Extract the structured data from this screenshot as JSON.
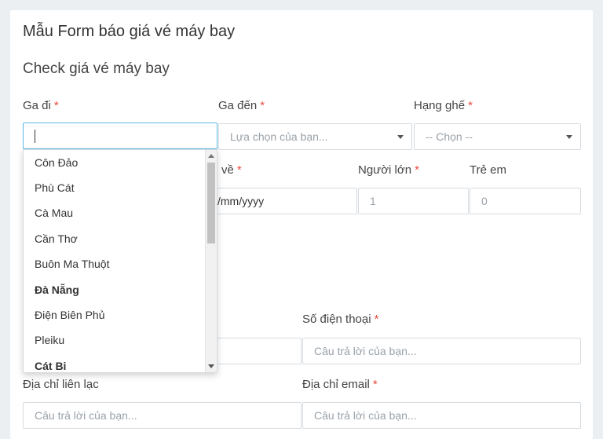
{
  "form": {
    "title": "Mẫu Form báo giá vé máy bay",
    "section_title": "Check giá vé máy bay",
    "required_mark": "*"
  },
  "fields": {
    "departure": {
      "label": "Ga đi",
      "value": ""
    },
    "arrival": {
      "label": "Ga đến",
      "placeholder": "Lựa chọn của bạn..."
    },
    "seat_class": {
      "label": "Hạng ghế",
      "placeholder": "-- Chọn --"
    },
    "return_date": {
      "label": "về",
      "placeholder": "/mm/yyyy"
    },
    "adults": {
      "label": "Người lớn",
      "placeholder": "1"
    },
    "children": {
      "label": "Trẻ em",
      "placeholder": "0"
    },
    "phone": {
      "label": "Số điện thoại",
      "placeholder": "Câu trả lời của bạn..."
    },
    "address": {
      "label": "Địa chỉ liên lạc",
      "placeholder": "Câu trả lời của bạn..."
    },
    "email": {
      "label": "Địa chỉ email",
      "placeholder": "Câu trả lời của bạn..."
    }
  },
  "dropdown": {
    "items": [
      {
        "label": "Côn Đảo",
        "bold": false
      },
      {
        "label": "Phù Cát",
        "bold": false
      },
      {
        "label": "Cà Mau",
        "bold": false
      },
      {
        "label": "Cần Thơ",
        "bold": false
      },
      {
        "label": "Buôn Ma Thuột",
        "bold": false
      },
      {
        "label": "Đà Nẵng",
        "bold": true
      },
      {
        "label": "Điện Biên Phủ",
        "bold": false
      },
      {
        "label": "Pleiku",
        "bold": false
      },
      {
        "label": "Cát Bi",
        "bold": true
      }
    ]
  },
  "colors": {
    "required": "#e74c3c",
    "focus_border": "#5bb8e6",
    "page_background": "#eceff2"
  }
}
